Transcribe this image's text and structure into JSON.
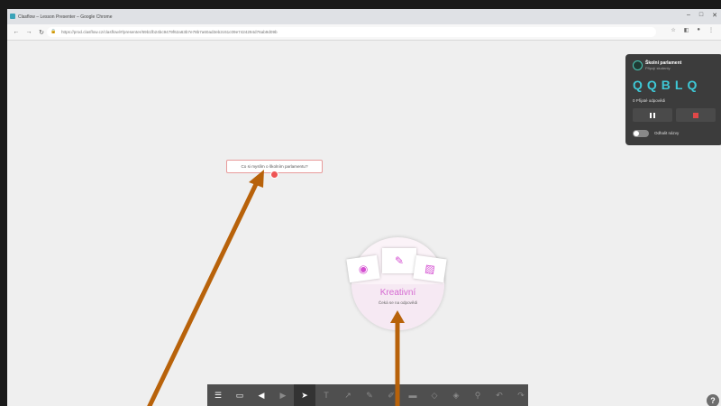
{
  "browser": {
    "window_title": "Clasflow – Lesson Presenter – Google Chrome",
    "url": "https://prod.clasflow.cz/clasflow/#/presenter/69b1fb24bc9479f62a63b7e78b7a60ad3eb2c61c09e7424294d76ab9d09b"
  },
  "question": {
    "text": "Co si myslím o školním parlamentu?"
  },
  "creative": {
    "title": "Kreativní",
    "subtitle": "Čeká se na odpovědi"
  },
  "panel": {
    "title": "Školní parlament",
    "subtitle": "Připojí studenty",
    "code": "QQBLQ",
    "responses": "0 Přijaté odpovědi",
    "toggle_label": "Odhalit názvy"
  },
  "toolbar": {
    "buttons": [
      "menu-icon",
      "slides-icon",
      "back-icon",
      "forward-icon",
      "select-icon",
      "text-icon",
      "arrow-tool-icon",
      "pen-icon",
      "highlighter-icon",
      "eraser-icon",
      "shape-icon",
      "fill-icon",
      "zoom-icon",
      "undo-icon",
      "redo-icon"
    ]
  },
  "colors": {
    "accent_pink": "#d44fd1",
    "code_cyan": "#3ec8d6",
    "annotation_arrow": "#b8620a",
    "stop_red": "#e04848"
  },
  "help": {
    "label": "?"
  }
}
